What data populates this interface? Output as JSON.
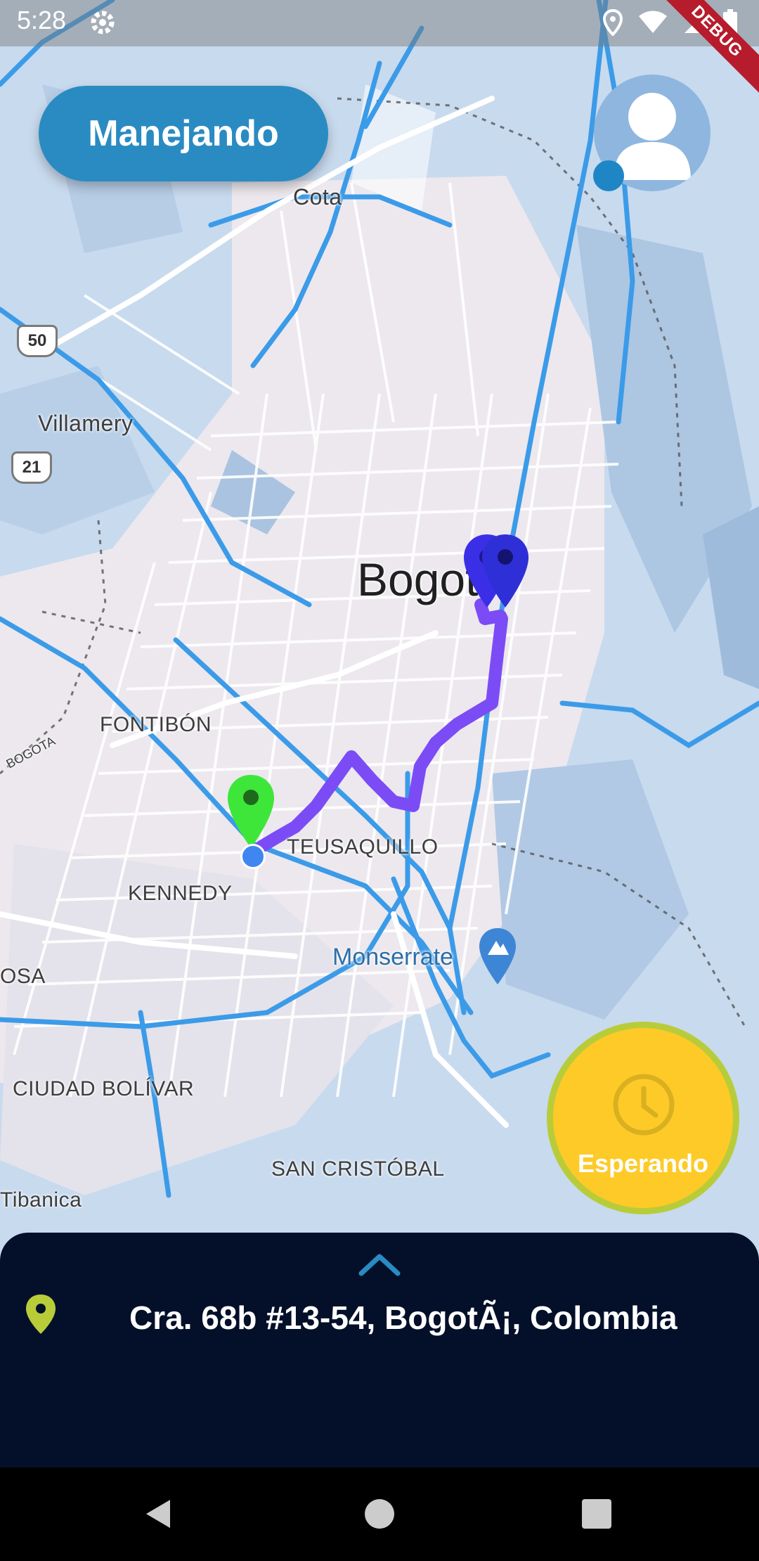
{
  "status_bar": {
    "time": "5:28",
    "icons": [
      "settings-icon",
      "location-icon",
      "wifi-icon",
      "signal-icon",
      "battery-icon"
    ],
    "debug_label": "DEBUG"
  },
  "mode_button": {
    "label": "Manejando",
    "color": "#2a8bc2"
  },
  "avatar": {
    "icon": "user-avatar-icon",
    "status_dot_color": "#1f86c6"
  },
  "map": {
    "labels": {
      "cota": "Cota",
      "villamery": "Villamery",
      "bogota": "Bogotá",
      "fontibon": "FONTIBÓN",
      "teusaquillo": "TEUSAQUILLO",
      "kennedy": "KENNEDY",
      "monserrate": "Monserrate",
      "osa": "OSA",
      "ciudad_bolivar": "CIUDAD BOLÍVAR",
      "san_cristobal": "SAN CRISTÓBAL",
      "tibanica": "Tibanica",
      "bogota_river": "BOGOTA"
    },
    "route_shields": [
      "50",
      "21"
    ],
    "route_color": "#7b4cf5",
    "origin_marker_color": "#3ee63a",
    "destination_marker_color": "#3a2fe6"
  },
  "wait_button": {
    "label": "Esperando",
    "icon": "clock-icon",
    "color": "#fdca28"
  },
  "bottom_panel": {
    "address": "Cra. 68b #13-54, BogotÃ¡, Colombia",
    "pin_icon": "location-pin-icon",
    "expand_icon": "chevron-up-icon"
  },
  "nav_bar": {
    "buttons": [
      "back",
      "home",
      "recents"
    ]
  }
}
